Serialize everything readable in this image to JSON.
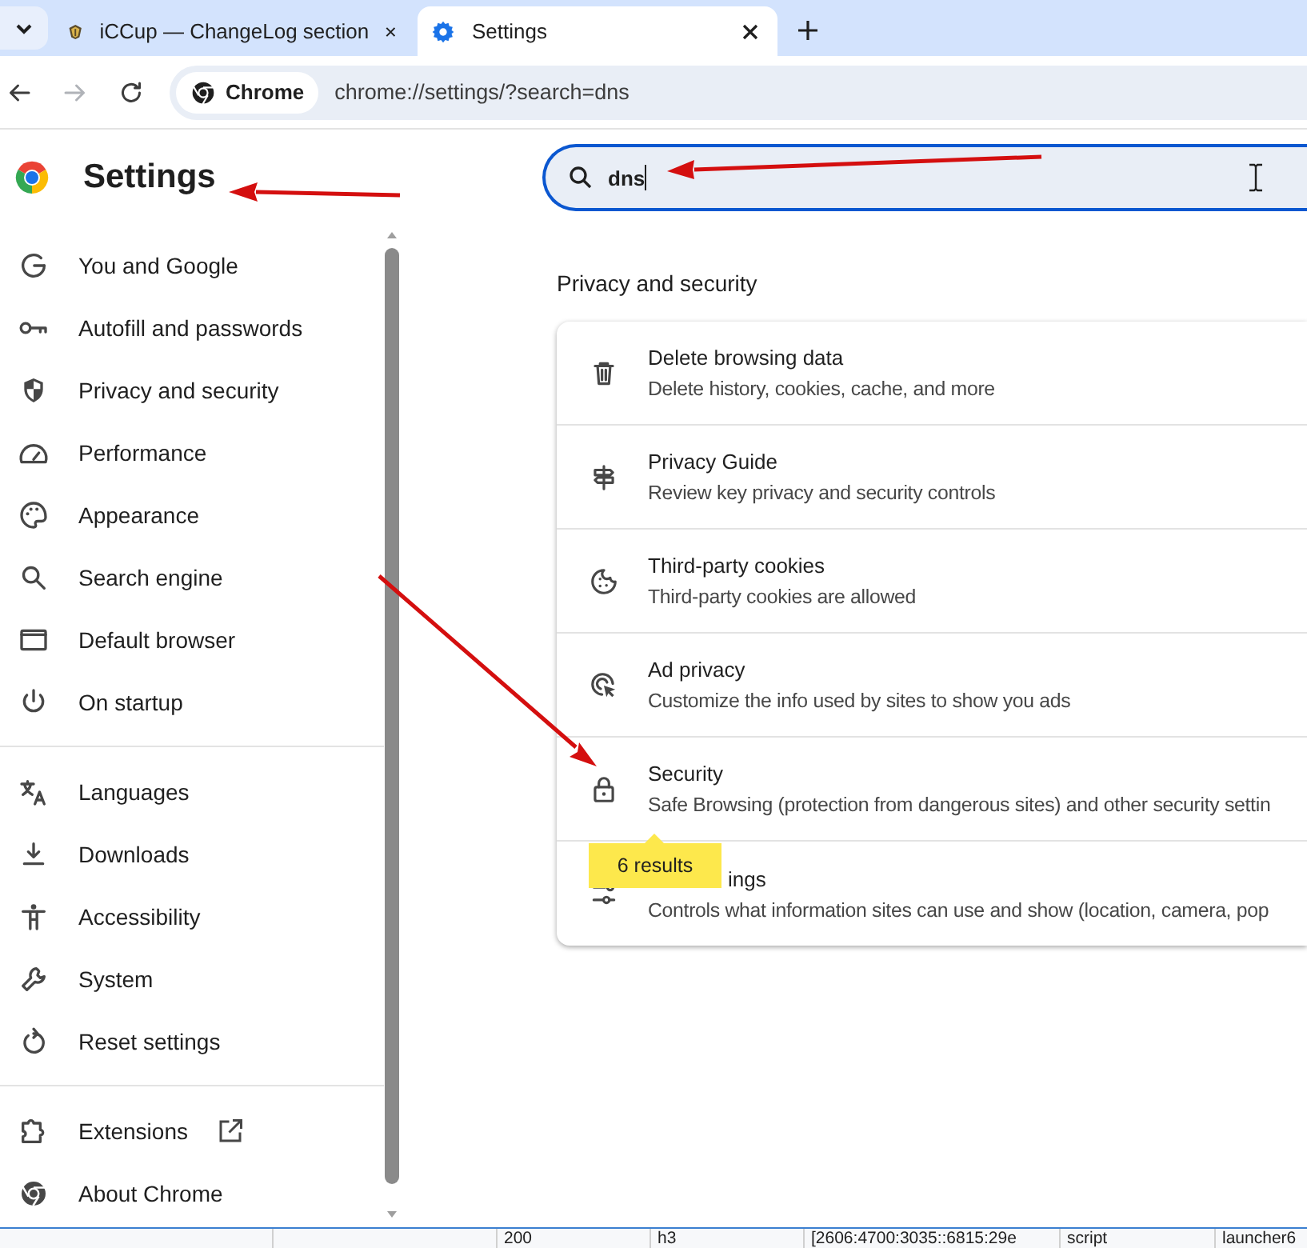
{
  "tab_strip": {
    "tabs": [
      {
        "title": "iCCup — ChangeLog section",
        "selected": false
      },
      {
        "title": "Settings",
        "selected": true
      }
    ]
  },
  "nav_buttons": [
    {
      "kind": "back",
      "disabled": false
    },
    {
      "kind": "forward",
      "disabled": true
    },
    {
      "kind": "reload",
      "disabled": false
    }
  ],
  "omnibox": {
    "chip": "Chrome",
    "url": "chrome://settings/?search=dns"
  },
  "settings_title": "Settings",
  "search": {
    "value": "dns"
  },
  "sidebar": {
    "groups": [
      [
        {
          "label": "You and Google",
          "selected": false,
          "external": false
        },
        {
          "label": "Autofill and passwords",
          "selected": false,
          "external": false
        },
        {
          "label": "Privacy and security",
          "selected": false,
          "external": false
        },
        {
          "label": "Performance",
          "selected": false,
          "external": false
        },
        {
          "label": "Appearance",
          "selected": false,
          "external": false
        },
        {
          "label": "Search engine",
          "selected": false,
          "external": false
        },
        {
          "label": "Default browser",
          "selected": false,
          "external": false
        },
        {
          "label": "On startup",
          "selected": false,
          "external": false
        }
      ],
      [
        {
          "label": "Languages",
          "selected": false,
          "external": false
        },
        {
          "label": "Downloads",
          "selected": false,
          "external": false
        },
        {
          "label": "Accessibility",
          "selected": false,
          "external": false
        },
        {
          "label": "System",
          "selected": false,
          "external": false
        },
        {
          "label": "Reset settings",
          "selected": false,
          "external": false
        }
      ],
      [
        {
          "label": "Extensions",
          "selected": false,
          "external": true
        },
        {
          "label": "About Chrome",
          "selected": false,
          "external": false
        }
      ]
    ]
  },
  "section_title": "Privacy and security",
  "results": [
    {
      "title": "Delete browsing data",
      "subtitle": "Delete history, cookies, cache, and more"
    },
    {
      "title": "Privacy Guide",
      "subtitle": "Review key privacy and security controls"
    },
    {
      "title": "Third-party cookies",
      "subtitle": "Third-party cookies are allowed"
    },
    {
      "title": "Ad privacy",
      "subtitle": "Customize the info used by sites to show you ads"
    },
    {
      "title": "Security",
      "subtitle": "Safe Browsing (protection from dangerous sites) and other security settin"
    },
    {
      "title": "ings",
      "subtitle": "Controls what information sites can use and show (location, camera, pop"
    }
  ],
  "results_badge": "6 results",
  "bottom_table": {
    "cells": [
      "200",
      "h3",
      "[2606:4700:3035::6815:29e",
      "script",
      "launcher6"
    ]
  }
}
